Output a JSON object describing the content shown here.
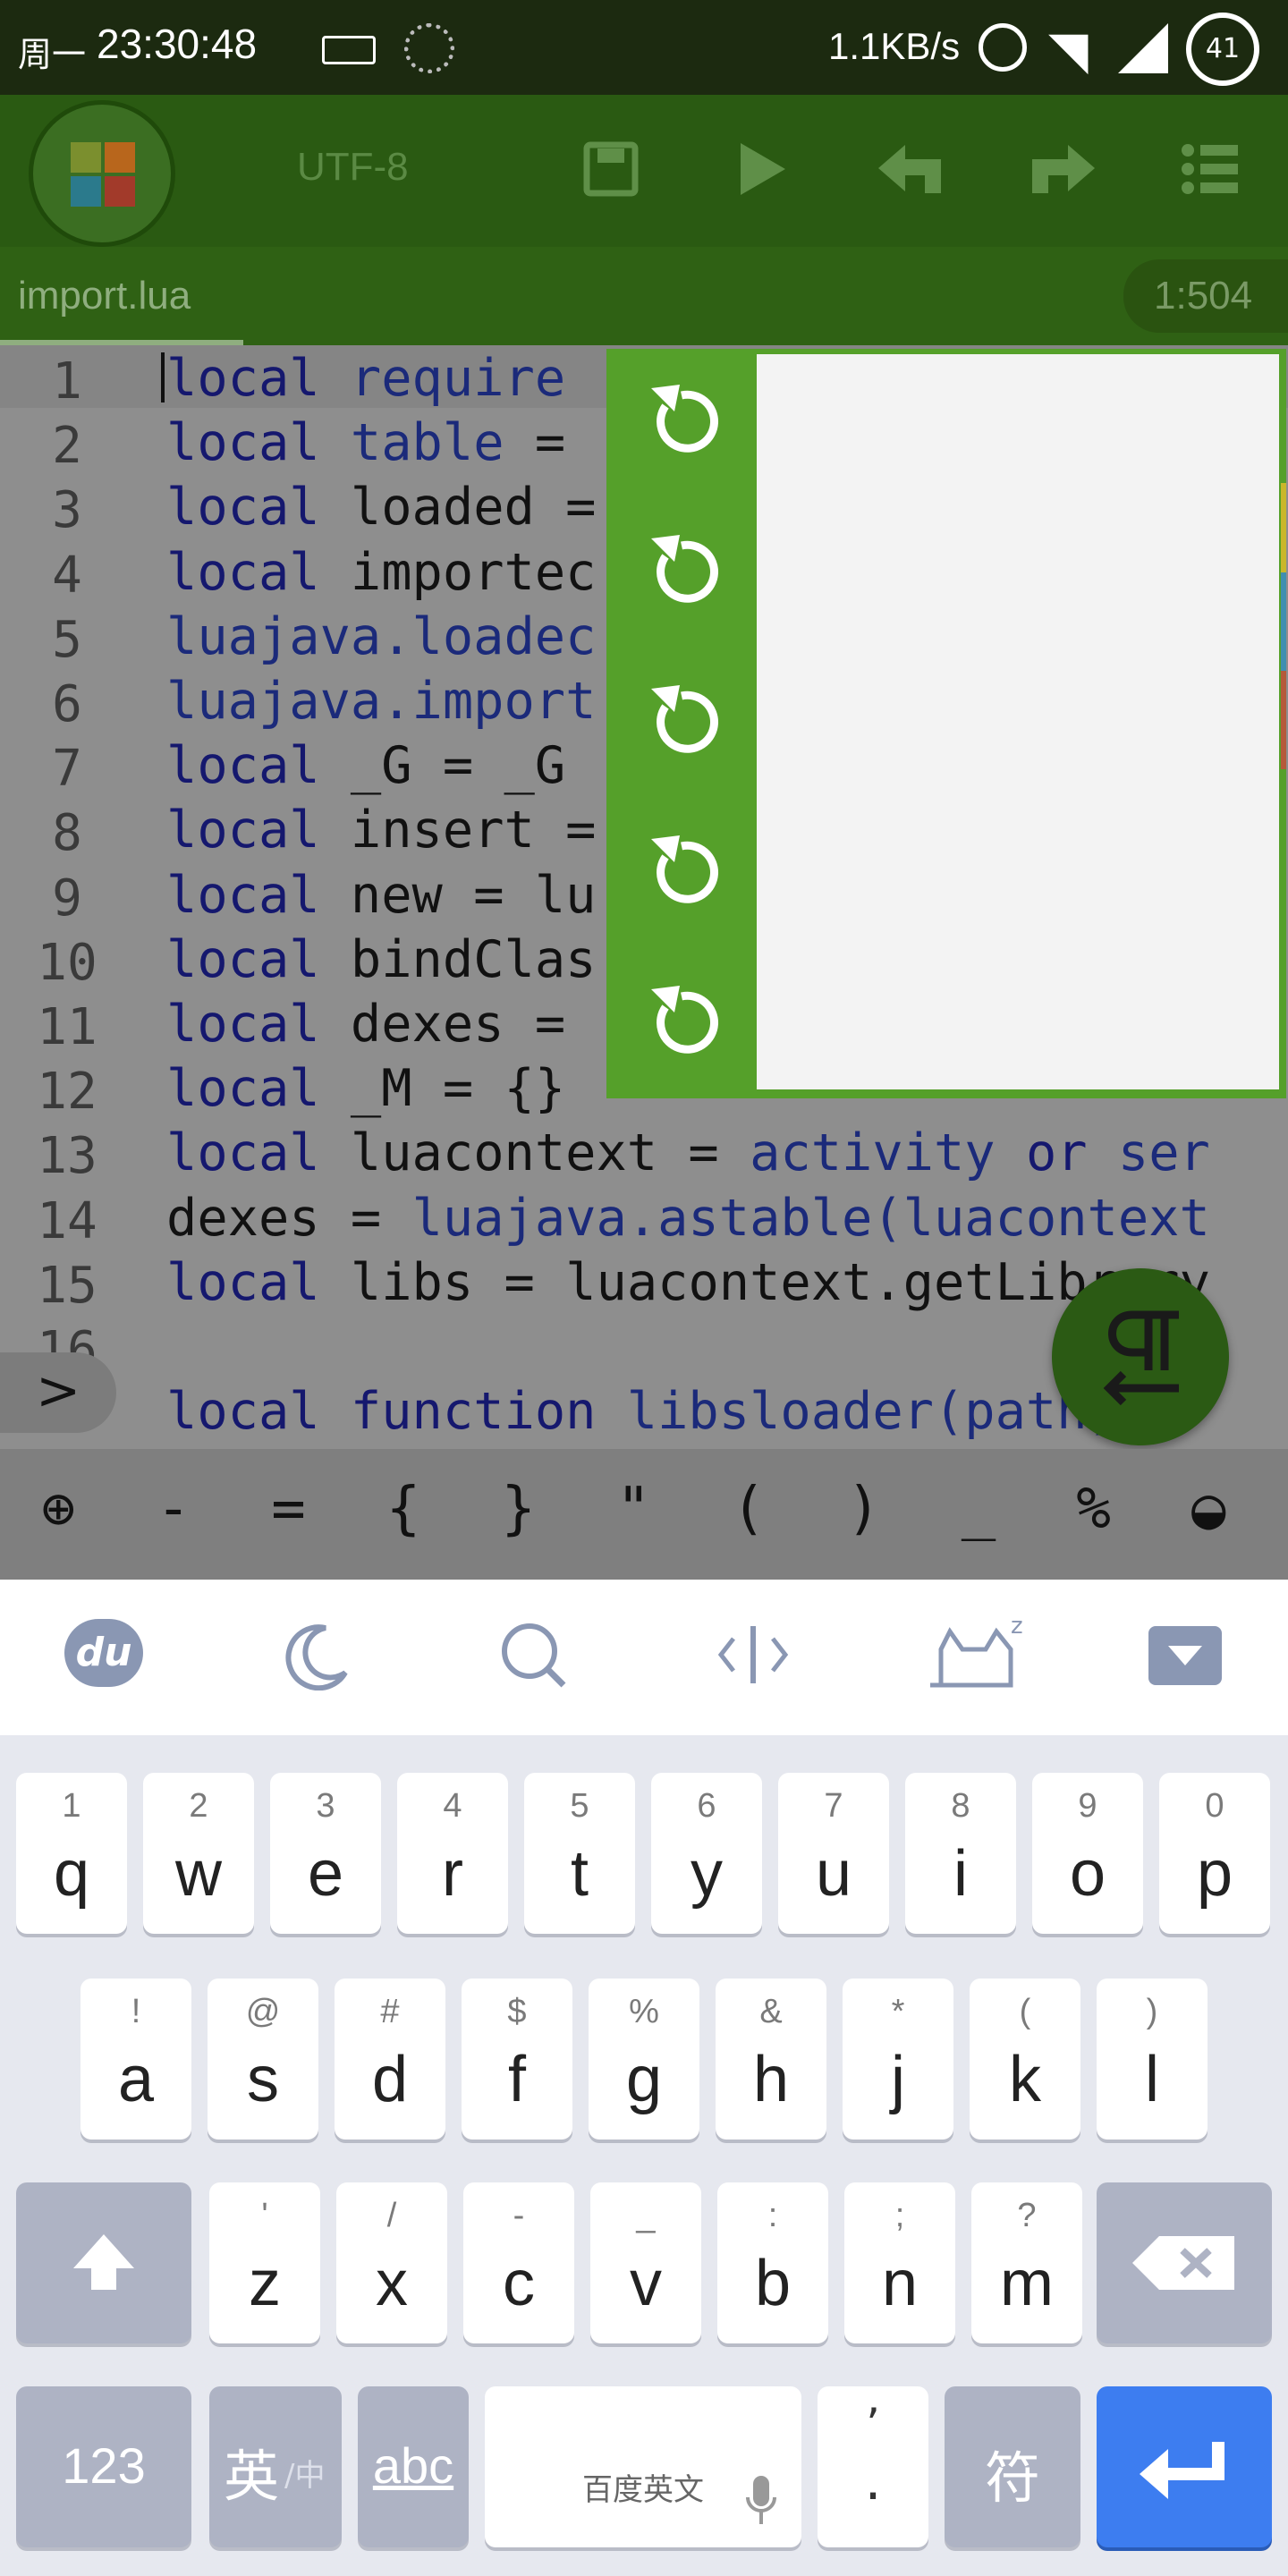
{
  "status": {
    "day": "周一",
    "time": "23:30:48",
    "net_speed": "1.1KB/s",
    "battery": "41"
  },
  "toolbar": {
    "encoding": "UTF-8"
  },
  "tab": {
    "name": "import.lua",
    "cursor_pos": "1:504"
  },
  "editor": {
    "line_numbers": [
      "1",
      "2",
      "3",
      "4",
      "5",
      "6",
      "7",
      "8",
      "9",
      "10",
      "11",
      "12",
      "13",
      "14",
      "15",
      "16"
    ],
    "lines": [
      "local require",
      "local table = ",
      "local loaded =",
      "local importec",
      "luajava.loadec",
      "luajava.import",
      "local _G = _G",
      "local insert =",
      "local new = lu",
      "local bindClas",
      "local dexes = ",
      "local _M = {}",
      "local luacontext = activity or ser",
      "dexes = luajava.astable(luacontext",
      "local libs = luacontext.getLibrary",
      ""
    ],
    "next_line": "local function libsloader(path)",
    "prompt": ">"
  },
  "popup": {
    "undo_count": 5
  },
  "symbols": [
    "⊕",
    "-",
    "=",
    "{",
    "}",
    "\"",
    "(",
    ")",
    "_",
    "%",
    "◒"
  ],
  "keyboard": {
    "row1": [
      {
        "hint": "1",
        "ch": "q"
      },
      {
        "hint": "2",
        "ch": "w"
      },
      {
        "hint": "3",
        "ch": "e"
      },
      {
        "hint": "4",
        "ch": "r"
      },
      {
        "hint": "5",
        "ch": "t"
      },
      {
        "hint": "6",
        "ch": "y"
      },
      {
        "hint": "7",
        "ch": "u"
      },
      {
        "hint": "8",
        "ch": "i"
      },
      {
        "hint": "9",
        "ch": "o"
      },
      {
        "hint": "0",
        "ch": "p"
      }
    ],
    "row2": [
      {
        "hint": "!",
        "ch": "a"
      },
      {
        "hint": "@",
        "ch": "s"
      },
      {
        "hint": "#",
        "ch": "d"
      },
      {
        "hint": "$",
        "ch": "f"
      },
      {
        "hint": "%",
        "ch": "g"
      },
      {
        "hint": "&",
        "ch": "h"
      },
      {
        "hint": "*",
        "ch": "j"
      },
      {
        "hint": "(",
        "ch": "k"
      },
      {
        "hint": ")",
        "ch": "l"
      }
    ],
    "row3": [
      {
        "hint": "'",
        "ch": "z"
      },
      {
        "hint": "/",
        "ch": "x"
      },
      {
        "hint": "-",
        "ch": "c"
      },
      {
        "hint": "_",
        "ch": "v"
      },
      {
        "hint": ":",
        "ch": "b"
      },
      {
        "hint": ";",
        "ch": "n"
      },
      {
        "hint": "?",
        "ch": "m"
      }
    ],
    "num_label": "123",
    "lang_label": "英",
    "lang_sub": "/中",
    "abc_label": "abc",
    "space_label": "百度英文",
    "comma_top": "’",
    "comma_bottom": "·",
    "symbol_label": "符"
  }
}
